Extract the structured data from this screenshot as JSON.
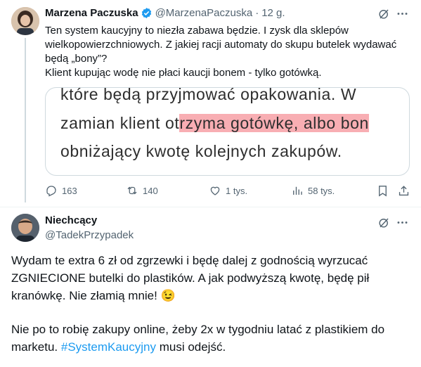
{
  "tweet": {
    "author_name": "Marzena Paczuska",
    "handle": "@MarzenaPaczuska",
    "separator": "·",
    "time": "12 g.",
    "text": "Ten system kaucyjny to niezła zabawa będzie. I zysk dla sklepów wielkopowierzchniowych. Z jakiej racji automaty do skupu butelek wydawać będą „bony”?\nKlient kupując wodę nie płaci kaucji bonem - tylko gotówką.",
    "image": {
      "line1": "które będą przyjmować opakowania. W",
      "line2_pre": "zamian klient ot",
      "line2_highlight": "rzyma gotówkę, albo bon",
      "line3": "obniżający kwotę kolejnych zakupów."
    },
    "actions": {
      "replies": "163",
      "reposts": "140",
      "likes": "1 tys.",
      "views": "58 tys."
    }
  },
  "reply": {
    "author_name": "Niechcący",
    "handle": "@TadekPrzypadek",
    "paragraph1": "Wydam te extra 6 zł od zgrzewki i będę dalej z godnością wyrzucać ZGNIECIONE butelki do plastików. A jak podwyższą kwotę, będę pił kranówkę. Nie złamią mnie! 😉",
    "paragraph2_pre": "Nie po to robię zakupy online, żeby 2x w tygodniu latać z plastikiem do marketu. ",
    "hashtag": "#SystemKaucyjny",
    "paragraph2_post": " musi odejść."
  },
  "colors": {
    "accent": "#1d9bf0",
    "verified": "#1d9bf0",
    "text": "#0f1419",
    "secondary": "#536471",
    "highlight": "#f4828a"
  }
}
